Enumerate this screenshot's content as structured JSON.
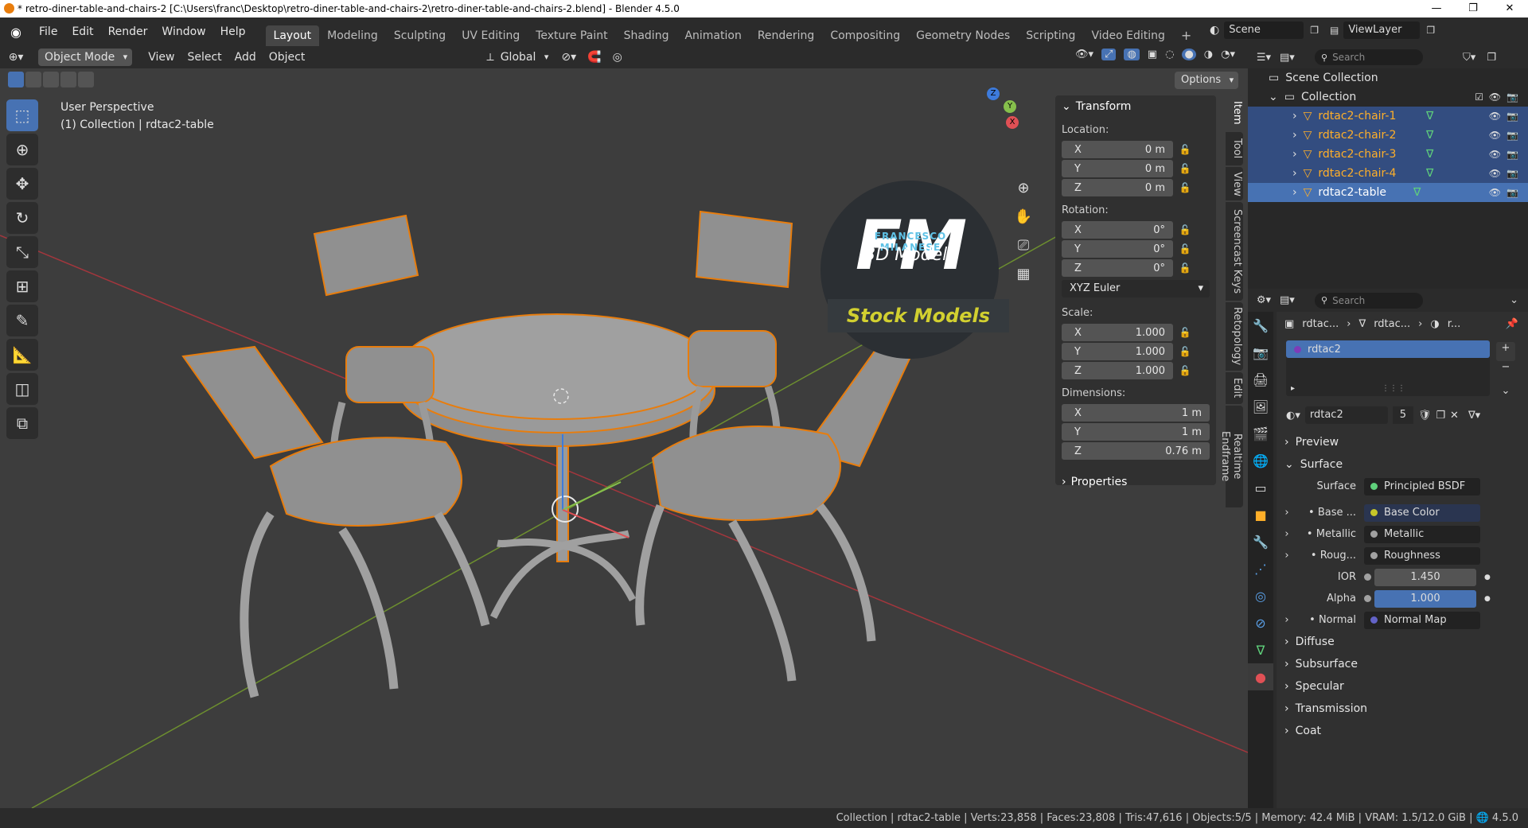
{
  "window": {
    "title": "* retro-diner-table-and-chairs-2 [C:\\Users\\franc\\Desktop\\retro-diner-table-and-chairs-2\\retro-diner-table-and-chairs-2.blend] - Blender 4.5.0",
    "minimize": "—",
    "maximize": "❐",
    "close": "✕"
  },
  "menu": [
    "File",
    "Edit",
    "Render",
    "Window",
    "Help"
  ],
  "workspaces": [
    "Layout",
    "Modeling",
    "Sculpting",
    "UV Editing",
    "Texture Paint",
    "Shading",
    "Animation",
    "Rendering",
    "Compositing",
    "Geometry Nodes",
    "Scripting",
    "Video Editing"
  ],
  "workspace_add": "+",
  "scene": {
    "name": "Scene",
    "view_layer": "ViewLayer"
  },
  "viewport_header": {
    "mode": "Object Mode",
    "menus": [
      "View",
      "Select",
      "Add",
      "Object"
    ],
    "orientation": "Global",
    "options": "Options"
  },
  "viewport": {
    "perspective": "User Perspective",
    "collection_info": "(1) Collection | rdtac2-table",
    "logo_letters": "FM",
    "logo_name": "FRANCESCO MILANESE",
    "logo_sub": "3D Models",
    "stock_label": "Stock Models",
    "gizmo_x": "X",
    "gizmo_y": "Y",
    "gizmo_z": "Z"
  },
  "transform": {
    "header": "Transform",
    "location_label": "Location:",
    "location": [
      {
        "axis": "X",
        "value": "0 m"
      },
      {
        "axis": "Y",
        "value": "0 m"
      },
      {
        "axis": "Z",
        "value": "0 m"
      }
    ],
    "rotation_label": "Rotation:",
    "rotation": [
      {
        "axis": "X",
        "value": "0°"
      },
      {
        "axis": "Y",
        "value": "0°"
      },
      {
        "axis": "Z",
        "value": "0°"
      }
    ],
    "rotation_mode": "XYZ Euler",
    "scale_label": "Scale:",
    "scale": [
      {
        "axis": "X",
        "value": "1.000"
      },
      {
        "axis": "Y",
        "value": "1.000"
      },
      {
        "axis": "Z",
        "value": "1.000"
      }
    ],
    "dimensions_label": "Dimensions:",
    "dimensions": [
      {
        "axis": "X",
        "value": "1 m"
      },
      {
        "axis": "Y",
        "value": "1 m"
      },
      {
        "axis": "Z",
        "value": "0.76 m"
      }
    ],
    "properties": "Properties"
  },
  "side_tabs": [
    "Item",
    "Tool",
    "View",
    "Screencast Keys",
    "Retopology",
    "Edit",
    "Realtime Endframe"
  ],
  "outliner": {
    "search_placeholder": "Search",
    "scene_collection": "Scene Collection",
    "collection": "Collection",
    "items": [
      "rdtac2-chair-1",
      "rdtac2-chair-2",
      "rdtac2-chair-3",
      "rdtac2-chair-4",
      "rdtac2-table"
    ]
  },
  "properties": {
    "search_placeholder": "Search",
    "breadcrumb": [
      "rdtac...",
      "rdtac...",
      "r..."
    ],
    "material_slot": "rdtac2",
    "material_name": "rdtac2",
    "user_count": "5",
    "preview": "Preview",
    "surface_section": "Surface",
    "surface_label": "Surface",
    "surface_value": "Principled BSDF",
    "inputs": [
      {
        "label": "Base ...",
        "value": "Base Color",
        "color": "#c7c729"
      },
      {
        "label": "Metallic",
        "value": "Metallic",
        "color": "#a1a1a1"
      },
      {
        "label": "Roug...",
        "value": "Roughness",
        "color": "#a1a1a1"
      }
    ],
    "ior_label": "IOR",
    "ior": "1.450",
    "alpha_label": "Alpha",
    "alpha": "1.000",
    "normal_label": "Normal",
    "normal_value": "Normal Map",
    "sections": [
      "Diffuse",
      "Subsurface",
      "Specular",
      "Transmission",
      "Coat"
    ]
  },
  "status": {
    "text": "Collection | rdtac2-table | Verts:23,858 | Faces:23,808 | Tris:47,616 | Objects:5/5 | Memory: 42.4 MiB | VRAM: 1.5/12.0 GiB | ",
    "version": "4.5.0"
  },
  "colors": {
    "accent": "#4772b3",
    "selected_outline": "#e87d0d",
    "object_name": "#ffaf29"
  }
}
